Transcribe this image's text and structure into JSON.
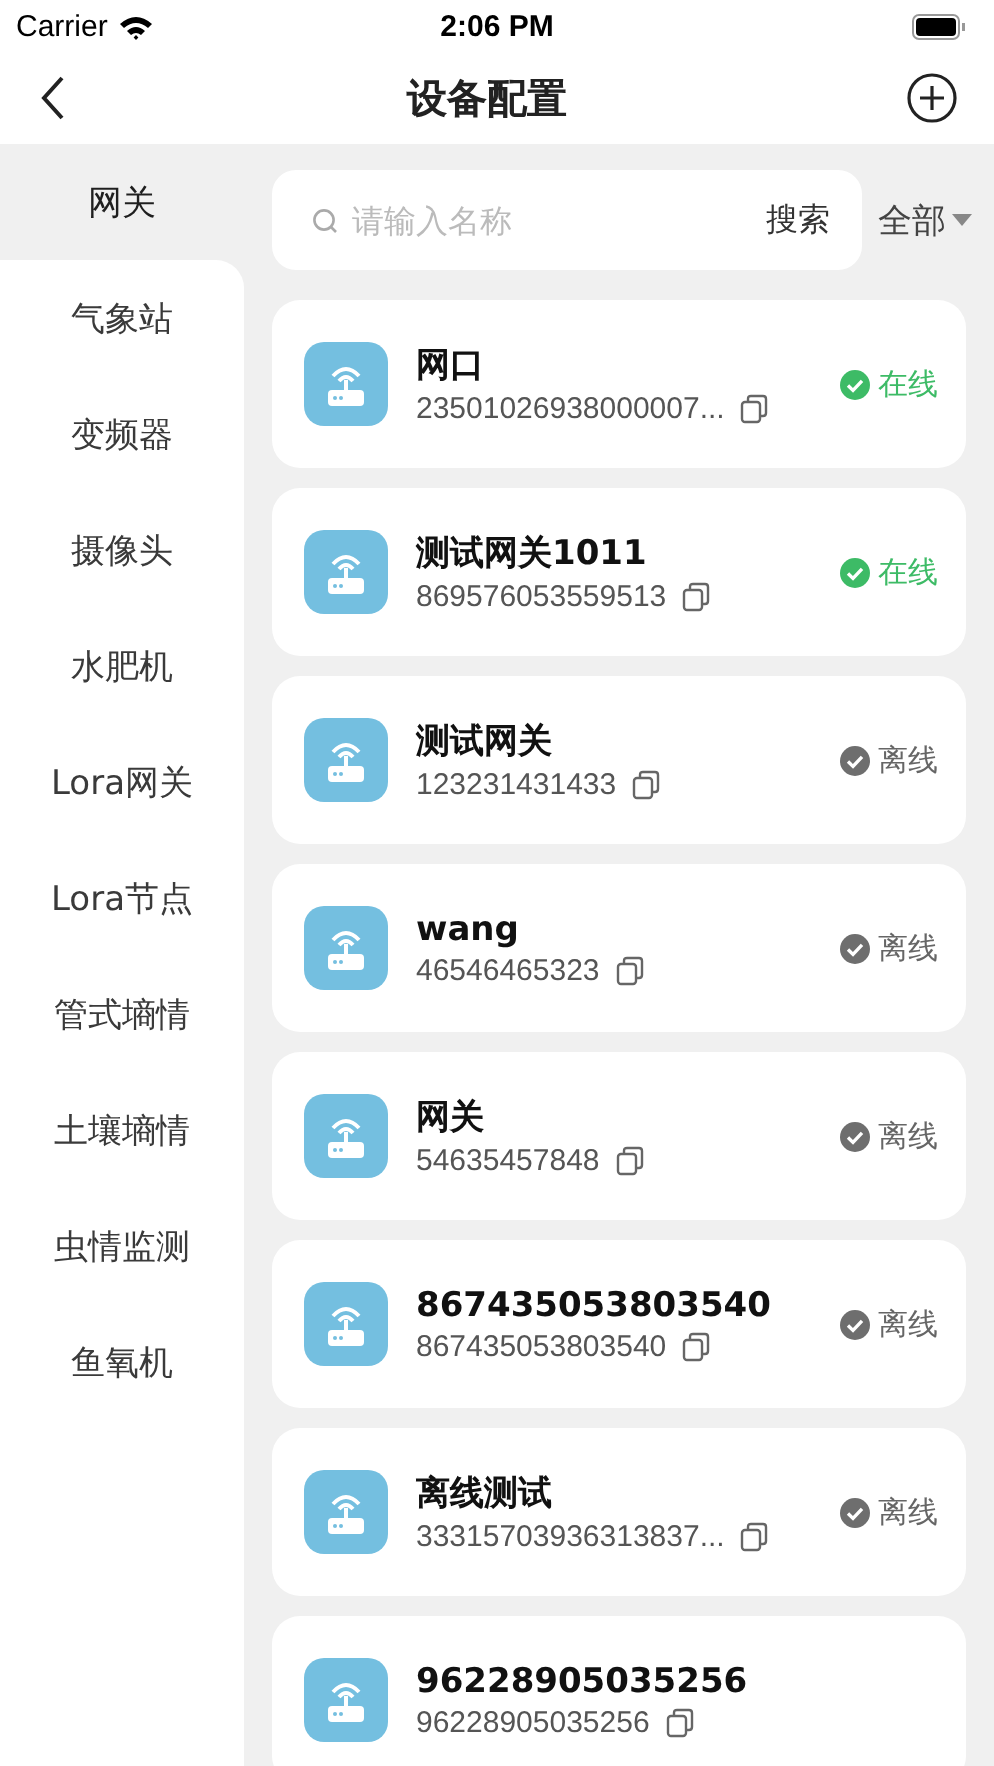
{
  "status_bar": {
    "carrier": "Carrier",
    "time": "2:06 PM"
  },
  "nav": {
    "title": "设备配置"
  },
  "sidebar": {
    "items": [
      {
        "label": "网关",
        "selected": true
      },
      {
        "label": "气象站",
        "selected": false
      },
      {
        "label": "变频器",
        "selected": false
      },
      {
        "label": "摄像头",
        "selected": false
      },
      {
        "label": "水肥机",
        "selected": false
      },
      {
        "label": "Lora网关",
        "selected": false
      },
      {
        "label": "Lora节点",
        "selected": false
      },
      {
        "label": "管式墒情",
        "selected": false
      },
      {
        "label": "土壤墒情",
        "selected": false
      },
      {
        "label": "虫情监测",
        "selected": false
      },
      {
        "label": "鱼氧机",
        "selected": false
      }
    ]
  },
  "search": {
    "placeholder": "请输入名称",
    "button": "搜索"
  },
  "filter": {
    "label": "全部"
  },
  "devices": [
    {
      "name": "网口",
      "serial": "23501026938000007...",
      "status": {
        "kind": "online",
        "label": "在线"
      }
    },
    {
      "name": "测试网关1011",
      "serial": "869576053559513",
      "status": {
        "kind": "online",
        "label": "在线"
      }
    },
    {
      "name": "测试网关",
      "serial": "123231431433",
      "status": {
        "kind": "offline",
        "label": "离线"
      }
    },
    {
      "name": "wang",
      "serial": "46546465323",
      "status": {
        "kind": "offline",
        "label": "离线"
      }
    },
    {
      "name": "网关",
      "serial": "54635457848",
      "status": {
        "kind": "offline",
        "label": "离线"
      }
    },
    {
      "name": "867435053803540",
      "serial": "867435053803540",
      "status": {
        "kind": "offline",
        "label": "离线"
      }
    },
    {
      "name": "离线测试",
      "serial": "33315703936313837...",
      "status": {
        "kind": "offline",
        "label": "离线"
      }
    },
    {
      "name": "96228905035256",
      "serial": "96228905035256"
    }
  ]
}
